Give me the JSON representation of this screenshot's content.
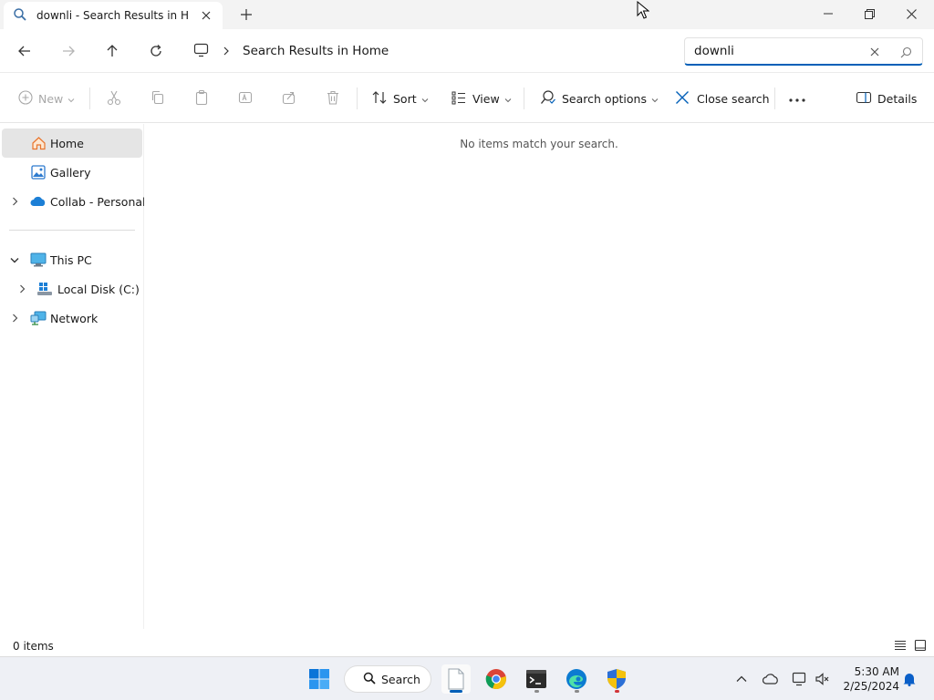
{
  "tab": {
    "title": "downli - Search Results in Home"
  },
  "address": {
    "location": "Search Results in Home"
  },
  "search": {
    "value": "downli"
  },
  "toolbar": {
    "new_label": "New",
    "sort_label": "Sort",
    "view_label": "View",
    "search_options_label": "Search options",
    "close_search_label": "Close search",
    "details_label": "Details"
  },
  "nav": {
    "home": "Home",
    "gallery": "Gallery",
    "onedrive": "Collab - Personal",
    "this_pc": "This PC",
    "local_disk": "Local Disk (C:)",
    "network": "Network"
  },
  "content": {
    "empty_message": "No items match your search."
  },
  "status": {
    "item_count": "0 items"
  },
  "taskbar": {
    "search_label": "Search",
    "time": "5:30 AM",
    "date": "2/25/2024"
  },
  "colors": {
    "accent": "#005fb8",
    "selected_bg": "#e5e5e5",
    "disabled_text": "#a8a8a8"
  }
}
